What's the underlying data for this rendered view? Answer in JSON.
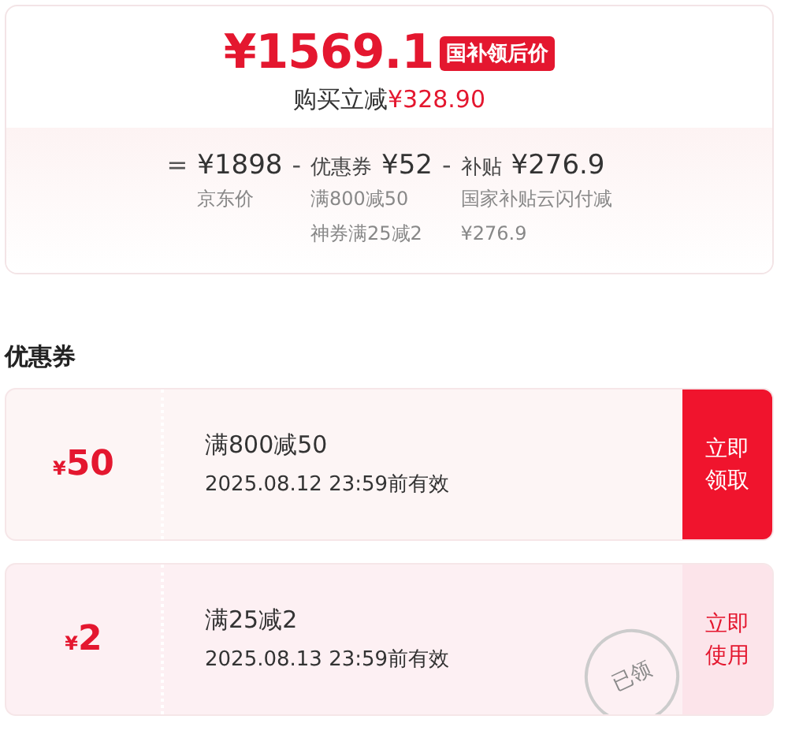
{
  "price_card": {
    "price": "¥1569.1",
    "price_tag": "国补领后价",
    "saving_label": "购买立减",
    "saving_amount": "¥328.90",
    "breakdown": [
      {
        "operator": "=",
        "amount": "¥1898",
        "notes": [
          "京东价"
        ]
      },
      {
        "operator": "-",
        "label": "优惠券",
        "amount": "¥52",
        "notes": [
          "满800减50",
          "神券满25减2"
        ]
      },
      {
        "operator": "-",
        "label": "补贴",
        "amount": "¥276.9",
        "notes": [
          "国家补贴云闪付减",
          "¥276.9"
        ]
      }
    ]
  },
  "coupon_section": {
    "title": "优惠券",
    "coupons": [
      {
        "currency": "¥",
        "value": "50",
        "condition": "满800减50",
        "validity": "2025.08.12 23:59前有效",
        "action": [
          "立即",
          "领取"
        ],
        "claimed": false
      },
      {
        "currency": "¥",
        "value": "2",
        "condition": "满25减2",
        "validity": "2025.08.13 23:59前有效",
        "action": [
          "立即",
          "使用"
        ],
        "claimed": true,
        "stamp": "已领"
      }
    ]
  }
}
